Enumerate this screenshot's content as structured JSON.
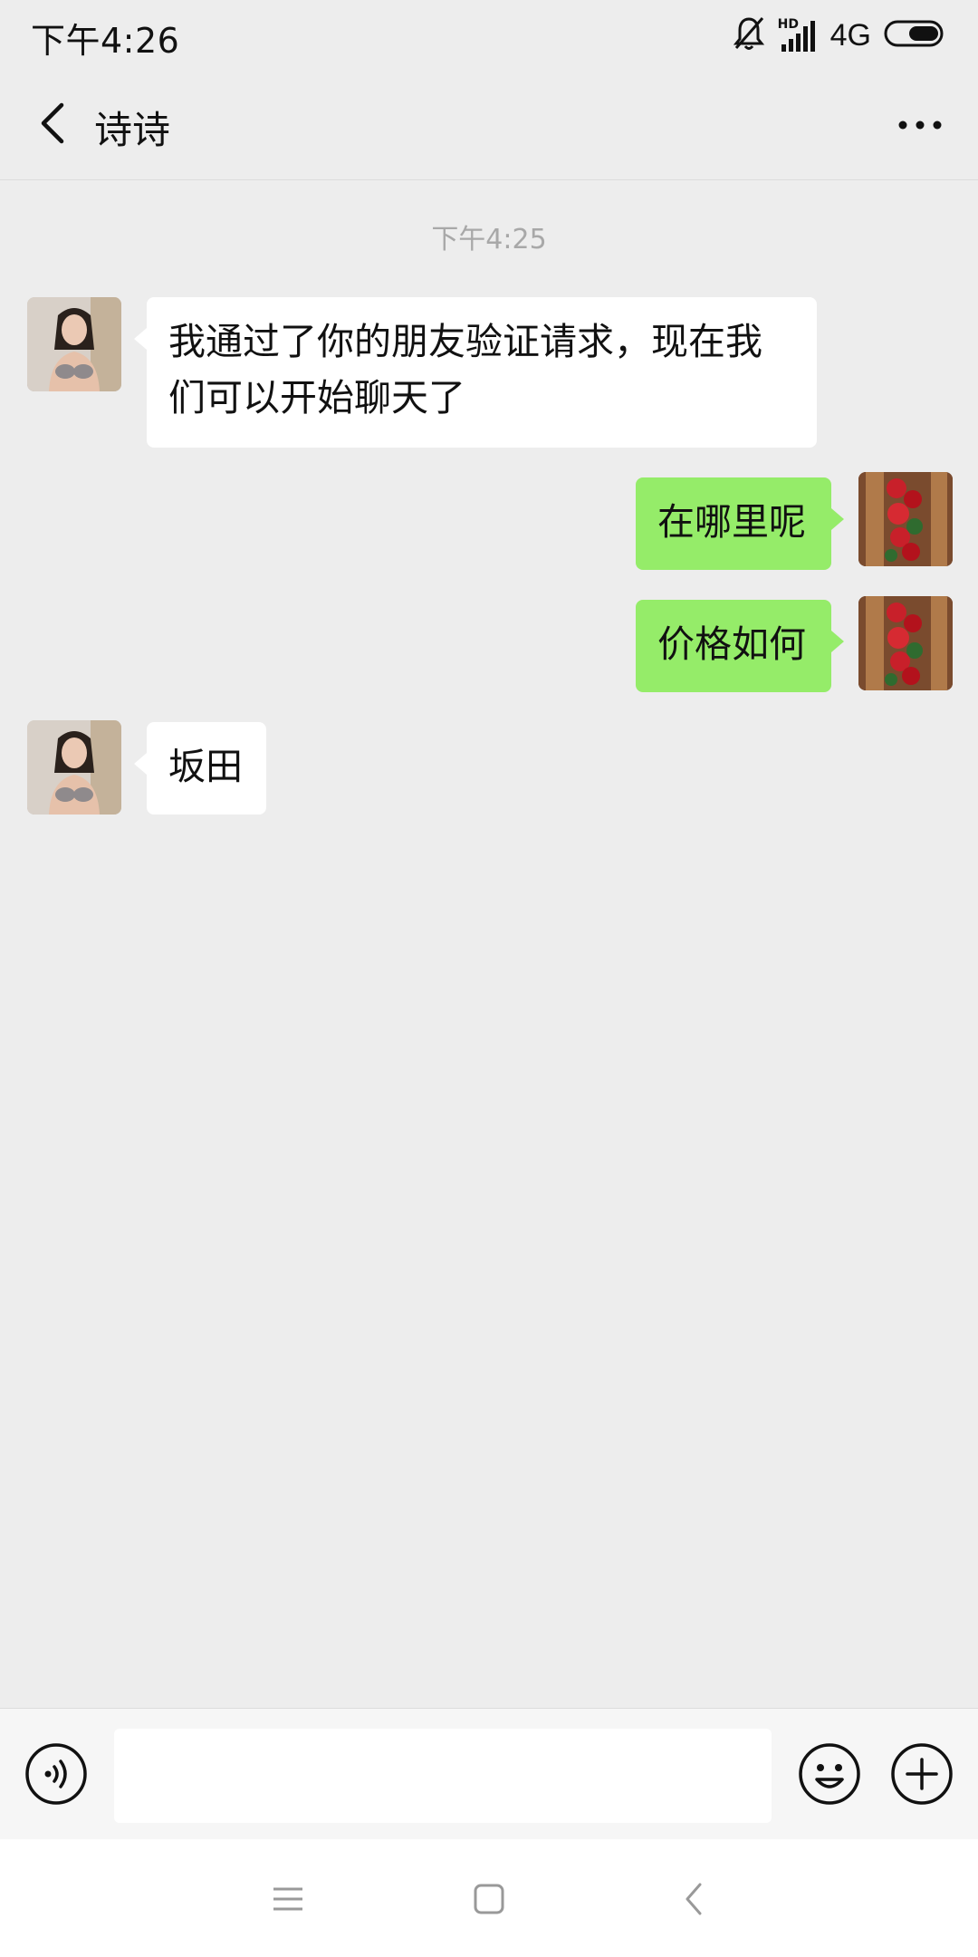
{
  "status_bar": {
    "time": "下午4:26",
    "network": "4G",
    "hd_label": "HD",
    "icons": [
      "mute-bell-icon",
      "signal-icon",
      "battery-icon"
    ]
  },
  "header": {
    "title": "诗诗",
    "back_icon": "chevron-left-icon",
    "more_icon": "more-dots-icon"
  },
  "chat": {
    "timestamp": "下午4:25",
    "messages": [
      {
        "side": "in",
        "text_line1": "我通过了你的朋友验证请求，现在我",
        "text_line2": "们可以开始聊天了"
      },
      {
        "side": "out",
        "text": "在哪里呢"
      },
      {
        "side": "out",
        "text": "价格如何"
      },
      {
        "side": "in",
        "text": "坂田"
      }
    ]
  },
  "input_bar": {
    "placeholder": "",
    "voice_icon": "voice-icon",
    "emoji_icon": "emoji-icon",
    "plus_icon": "plus-icon"
  },
  "nav_bar": {
    "icons": [
      "menu-icon",
      "home-icon",
      "back-icon"
    ]
  },
  "colors": {
    "background": "#ededed",
    "outgoing_bubble": "#95ec69",
    "incoming_bubble": "#ffffff",
    "timestamp": "#a8a8a8"
  }
}
